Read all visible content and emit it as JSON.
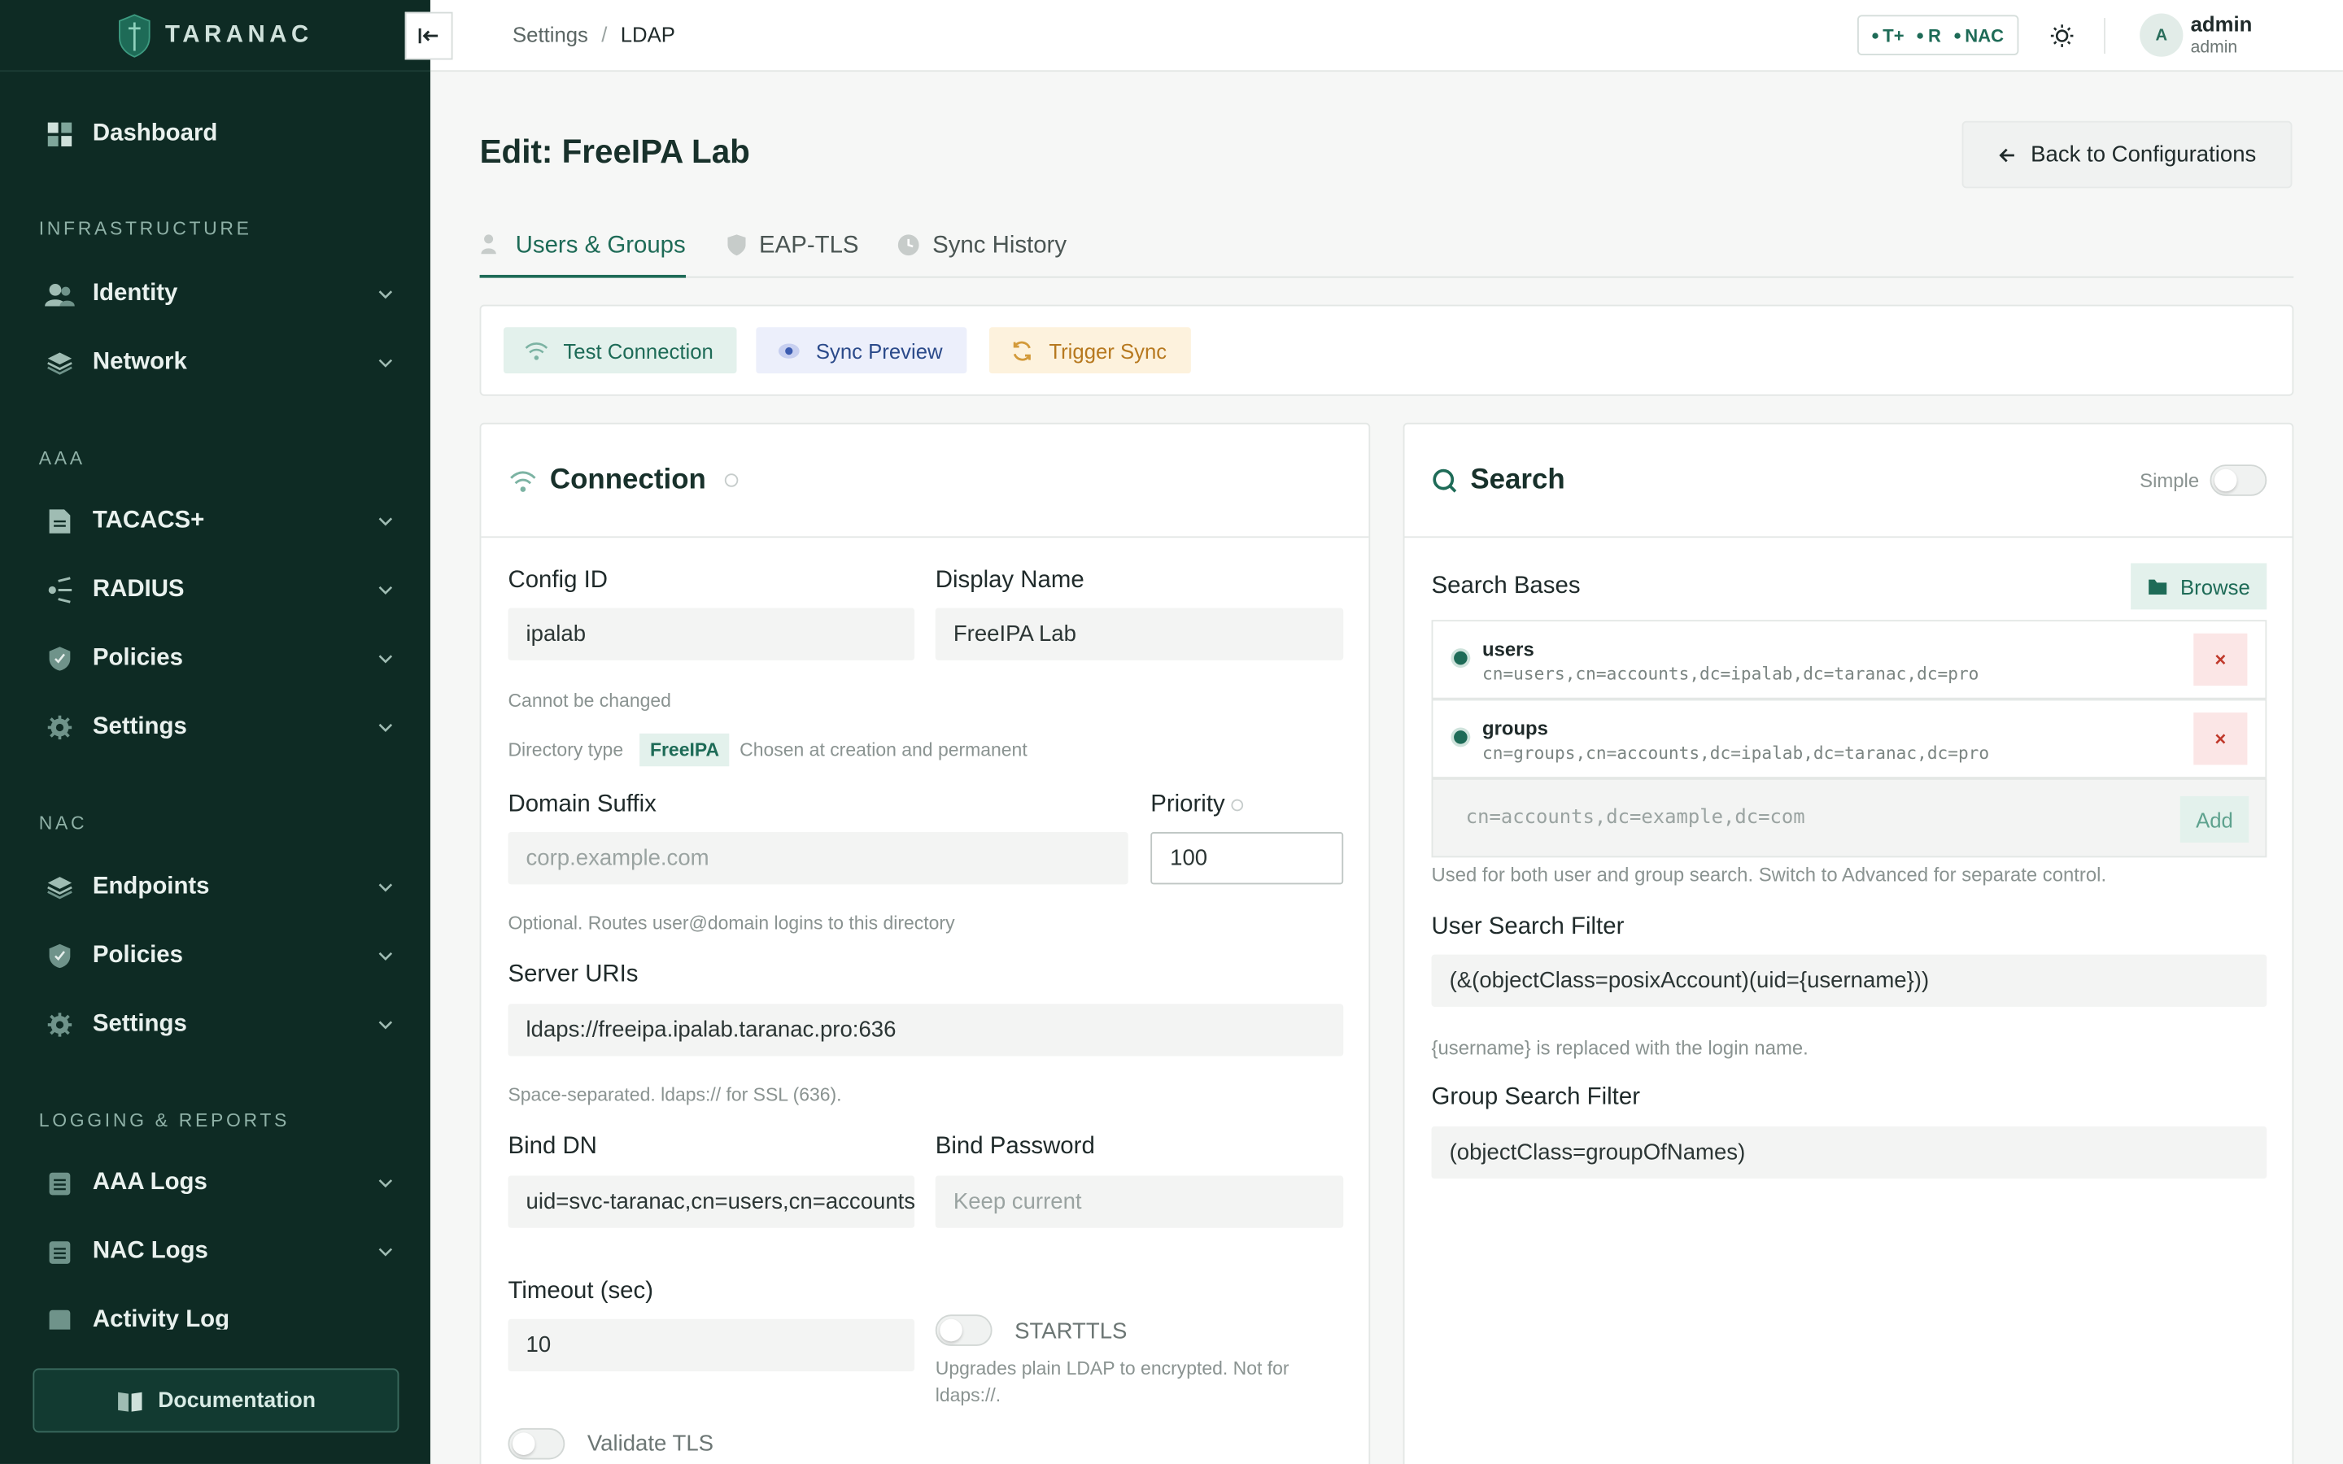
{
  "brand": {
    "name": "TARANAC"
  },
  "sidebar": {
    "sections": {
      "infrastructure": "INFRASTRUCTURE",
      "aaa": "AAA",
      "nac": "NAC",
      "logging": "LOGGING & REPORTS"
    },
    "items": {
      "dashboard": "Dashboard",
      "identity": "Identity",
      "network": "Network",
      "tacacs": "TACACS+",
      "radius": "RADIUS",
      "aaa_policies": "Policies",
      "aaa_settings": "Settings",
      "endpoints": "Endpoints",
      "nac_policies": "Policies",
      "nac_settings": "Settings",
      "aaa_logs": "AAA Logs",
      "nac_logs": "NAC Logs",
      "activity_log": "Activity Log"
    },
    "documentation": "Documentation"
  },
  "topbar": {
    "crumb_parent": "Settings",
    "crumb_sep": "/",
    "crumb_current": "LDAP",
    "protocols": [
      "T+",
      "R",
      "NAC"
    ],
    "user_name": "admin",
    "user_role": "admin",
    "avatar_initial": "A"
  },
  "page": {
    "title": "Edit: FreeIPA Lab",
    "back_label": "Back to Configurations",
    "tabs": [
      "Users & Groups",
      "EAP-TLS",
      "Sync History"
    ]
  },
  "actions": {
    "test": "Test Connection",
    "preview": "Sync Preview",
    "trigger": "Trigger Sync"
  },
  "connection": {
    "title": "Connection",
    "config_id_label": "Config ID",
    "config_id_value": "ipalab",
    "config_id_hint": "Cannot be changed",
    "display_name_label": "Display Name",
    "display_name_value": "FreeIPA Lab",
    "dir_type_label": "Directory type",
    "dir_type_value": "FreeIPA",
    "dir_type_hint": "Chosen at creation and permanent",
    "domain_suffix_label": "Domain Suffix",
    "domain_suffix_placeholder": "corp.example.com",
    "domain_suffix_hint": "Optional. Routes user@domain logins to this directory",
    "priority_label": "Priority",
    "priority_value": "100",
    "server_uris_label": "Server URIs",
    "server_uris_value": "ldaps://freeipa.ipalab.taranac.pro:636",
    "server_uris_hint": "Space-separated. ldaps:// for SSL (636).",
    "bind_dn_label": "Bind DN",
    "bind_dn_value": "uid=svc-taranac,cn=users,cn=accounts,dc=ipalab,dc=taranac,dc=pro",
    "bind_password_label": "Bind Password",
    "bind_password_placeholder": "Keep current",
    "timeout_label": "Timeout (sec)",
    "timeout_value": "10",
    "starttls_label": "STARTTLS",
    "starttls_hint": "Upgrades plain LDAP to encrypted. Not for ldaps://.",
    "validate_tls_label": "Validate TLS"
  },
  "search": {
    "title": "Search",
    "simple_label": "Simple",
    "bases_label": "Search Bases",
    "browse_label": "Browse",
    "bases": [
      {
        "name": "users",
        "dn": "cn=users,cn=accounts,dc=ipalab,dc=taranac,dc=pro"
      },
      {
        "name": "groups",
        "dn": "cn=groups,cn=accounts,dc=ipalab,dc=taranac,dc=pro"
      }
    ],
    "delete_symbol": "×",
    "add_placeholder": "cn=accounts,dc=example,dc=com",
    "add_label": "Add",
    "bases_hint": "Used for both user and group search. Switch to Advanced for separate control.",
    "user_filter_label": "User Search Filter",
    "user_filter_value": "(&(objectClass=posixAccount)(uid={username}))",
    "user_filter_hint": "{username} is replaced with the login name.",
    "group_filter_label": "Group Search Filter",
    "group_filter_value": "(objectClass=groupOfNames)"
  },
  "colors": {
    "sidebar_bg": "#0e2b24",
    "accent": "#1e6b57",
    "danger": "#c0392b",
    "warning": "#b7791f"
  }
}
